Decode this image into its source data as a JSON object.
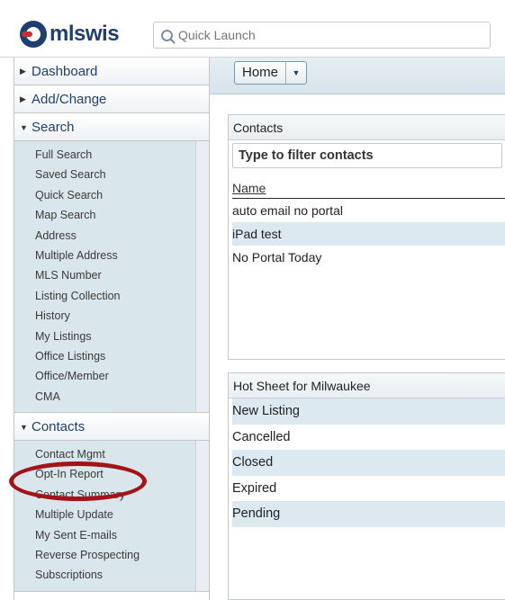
{
  "app": {
    "logo_text": "mlswis"
  },
  "quick_launch": {
    "placeholder": "Quick Launch"
  },
  "sidebar": {
    "dashboard": "Dashboard",
    "add_change": "Add/Change",
    "search": {
      "label": "Search",
      "items": [
        "Full Search",
        "Saved Search",
        "Quick Search",
        "Map Search",
        "Address",
        "Multiple Address",
        "MLS Number",
        "Listing Collection",
        "History",
        "My Listings",
        "Office Listings",
        "Office/Member",
        "CMA"
      ]
    },
    "contacts": {
      "label": "Contacts",
      "items": [
        "Contact Mgmt",
        "Opt-In Report",
        "Contact Summary",
        "Multiple Update",
        "My Sent E-mails",
        "Reverse Prospecting",
        "Subscriptions"
      ]
    }
  },
  "annotation": {
    "color": "#a31419",
    "target": "Opt-In Report"
  },
  "main": {
    "home_button": "Home",
    "contacts_panel": {
      "title": "Contacts",
      "filter_placeholder": "Type to filter contacts",
      "column_header": "Name",
      "rows": [
        "auto email no portal",
        "iPad test",
        "No Portal Today"
      ]
    },
    "hotsheet_panel": {
      "title": "Hot Sheet for Milwaukee",
      "rows": [
        "New Listing",
        "Cancelled",
        "Closed",
        "Expired",
        "Pending"
      ]
    }
  }
}
